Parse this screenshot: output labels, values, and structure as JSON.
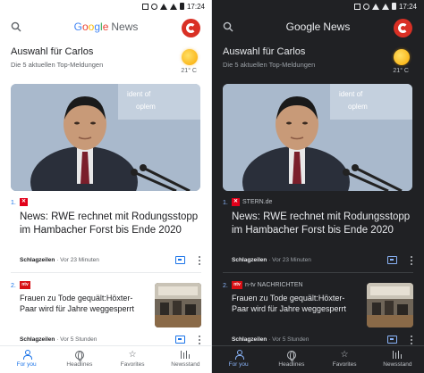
{
  "status": {
    "time": "17:24"
  },
  "app": {
    "logo_google": "Google",
    "logo_news": "News"
  },
  "briefing": {
    "title": "Auswahl für Carlos",
    "subtitle": "Die 5 aktuellen Top-Meldungen",
    "weather_temp": "21° C"
  },
  "story1": {
    "rank": "1.",
    "source_logo": "✕",
    "source_name_dark": "STERN.de",
    "title": "News: RWE rechnet mit Rodungsstopp im Hambacher Forst bis Ende 2020",
    "meta_label": "Schlagzeilen",
    "meta_time": "· Vor 23 Minuten"
  },
  "story2": {
    "rank": "2.",
    "source_logo": "ntv",
    "source_name_dark": "n-tv NACHRICHTEN",
    "title": "Frauen zu Tode gequält:Höxter-Paar wird für Jahre weggesperrt",
    "meta_label": "Schlagzeilen",
    "meta_time": "· Vor 5 Stunden"
  },
  "nav": {
    "items": [
      {
        "label": "For you",
        "icon": "person-icon"
      },
      {
        "label": "Headlines",
        "icon": "globe-icon"
      },
      {
        "label": "Favorites",
        "icon": "star-icon"
      },
      {
        "label": "Newsstand",
        "icon": "newsstand-icon"
      }
    ]
  },
  "colors": {
    "accent_light": "#1a73e8",
    "accent_dark": "#8ab4f8",
    "avatar": "#d93025",
    "dark_bg": "#202124"
  }
}
